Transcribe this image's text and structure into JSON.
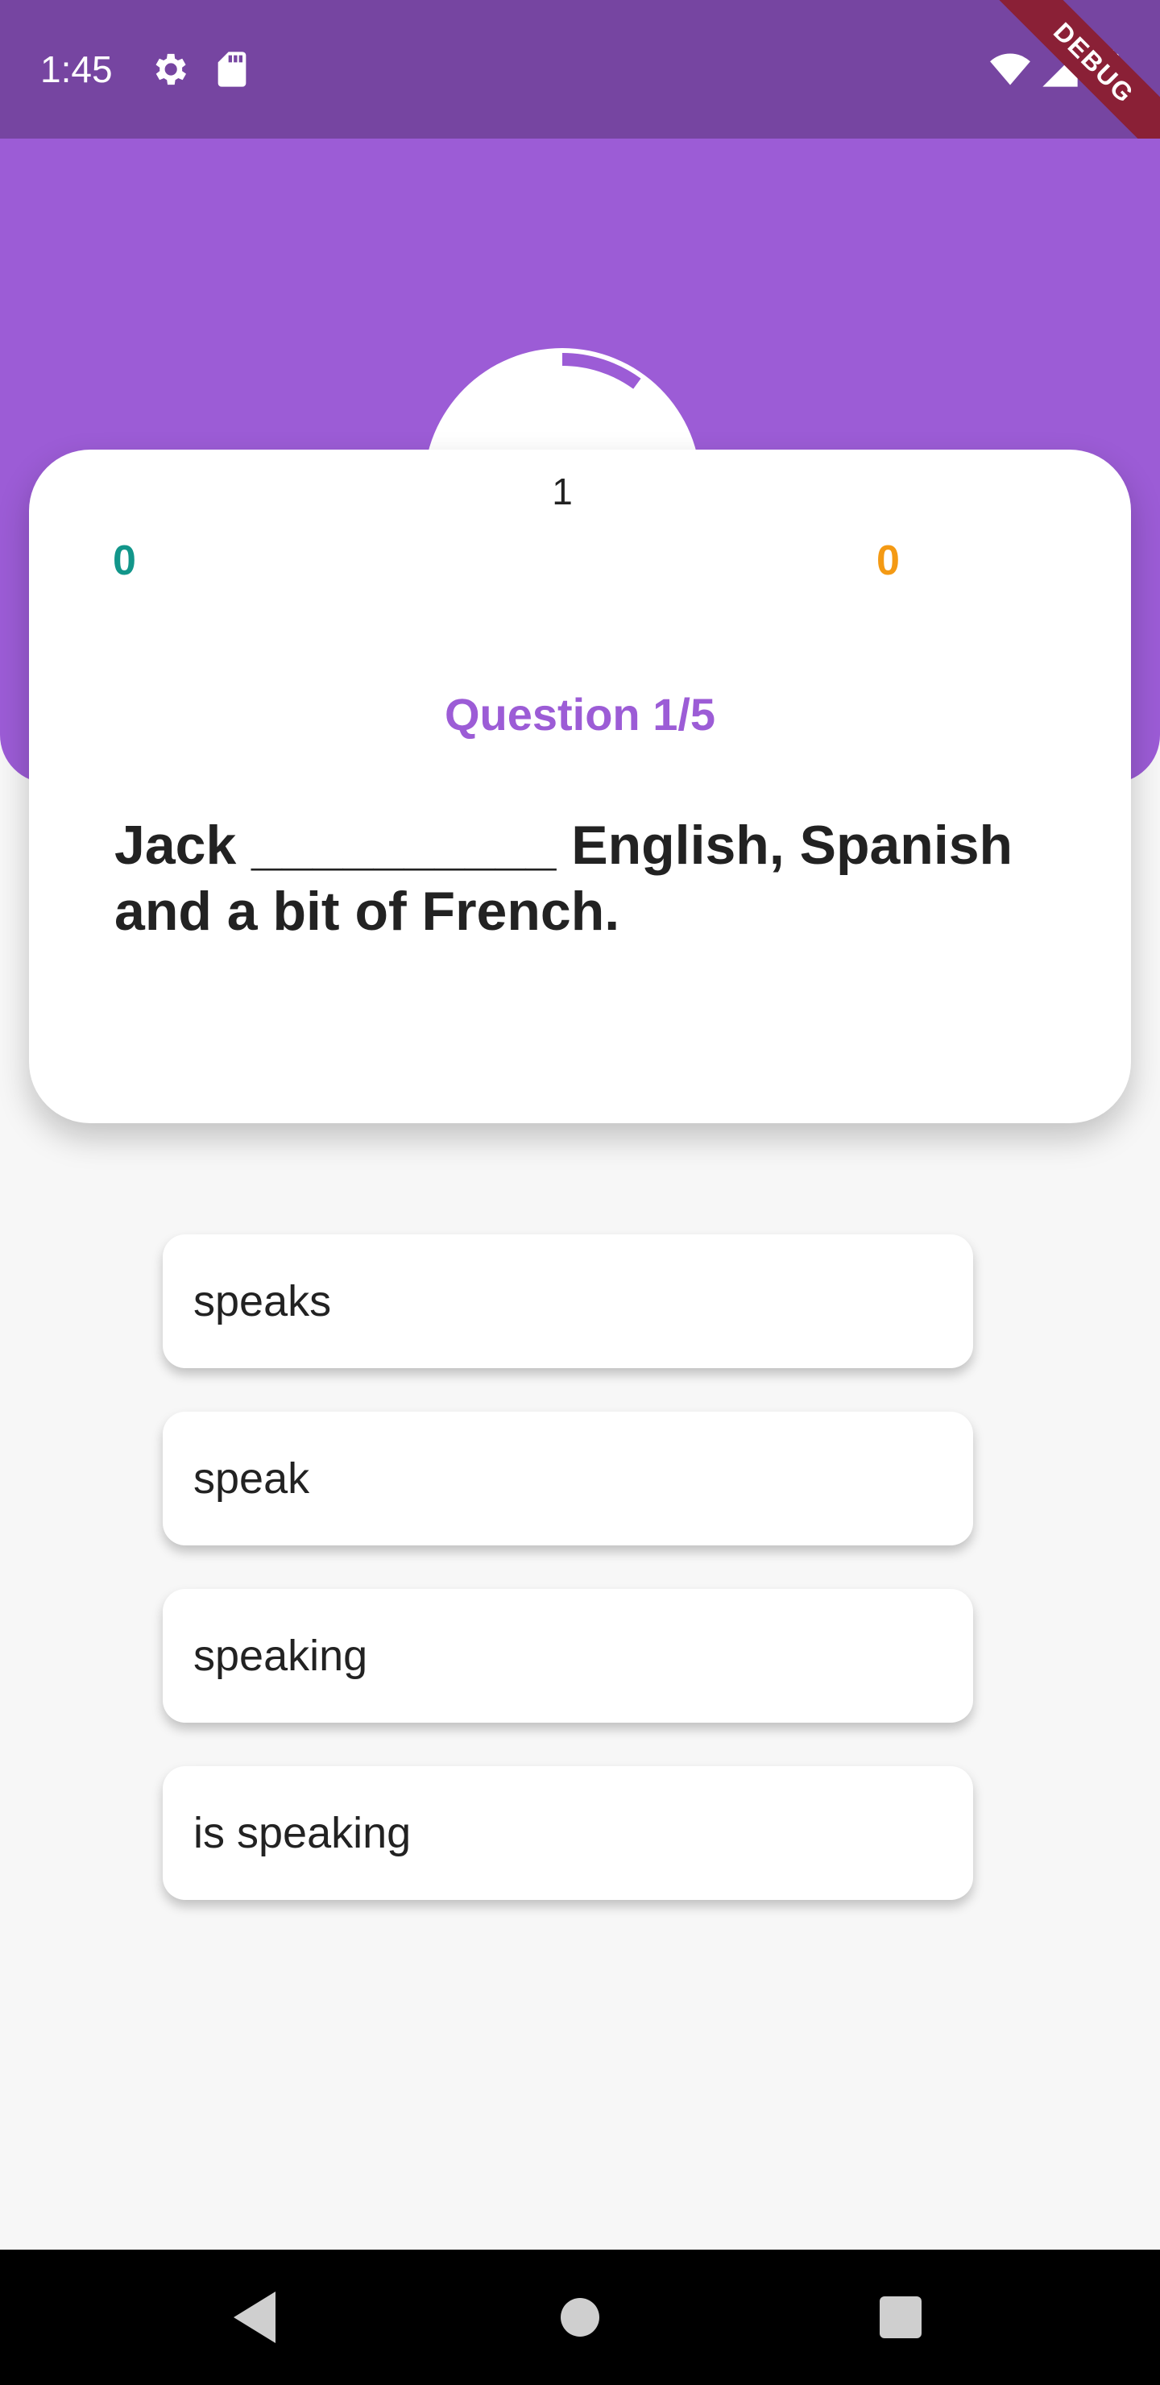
{
  "status_bar": {
    "time": "1:45",
    "left_icons": [
      "gear-icon",
      "sd-card-icon"
    ],
    "right_icons": [
      "wifi-icon",
      "signal-icon",
      "battery-icon"
    ],
    "debug_label": "DEBUG"
  },
  "quiz": {
    "timer_value": "1",
    "timer_progress": 0.1,
    "correct_score": "0",
    "wrong_score": "0",
    "question_number": "Question 1/5",
    "question_text": "Jack __________ English, Spanish and a bit of French.",
    "options": [
      {
        "label": "speaks"
      },
      {
        "label": "speak"
      },
      {
        "label": "speaking"
      },
      {
        "label": "is speaking"
      }
    ]
  },
  "nav_bar": {
    "buttons": [
      "back-icon",
      "home-icon",
      "recents-icon"
    ]
  },
  "colors": {
    "primary": "#9c5cd6",
    "status_bar": "#7645a1",
    "correct": "#12968a",
    "wrong": "#f49a14",
    "debug": "#8a2036"
  }
}
